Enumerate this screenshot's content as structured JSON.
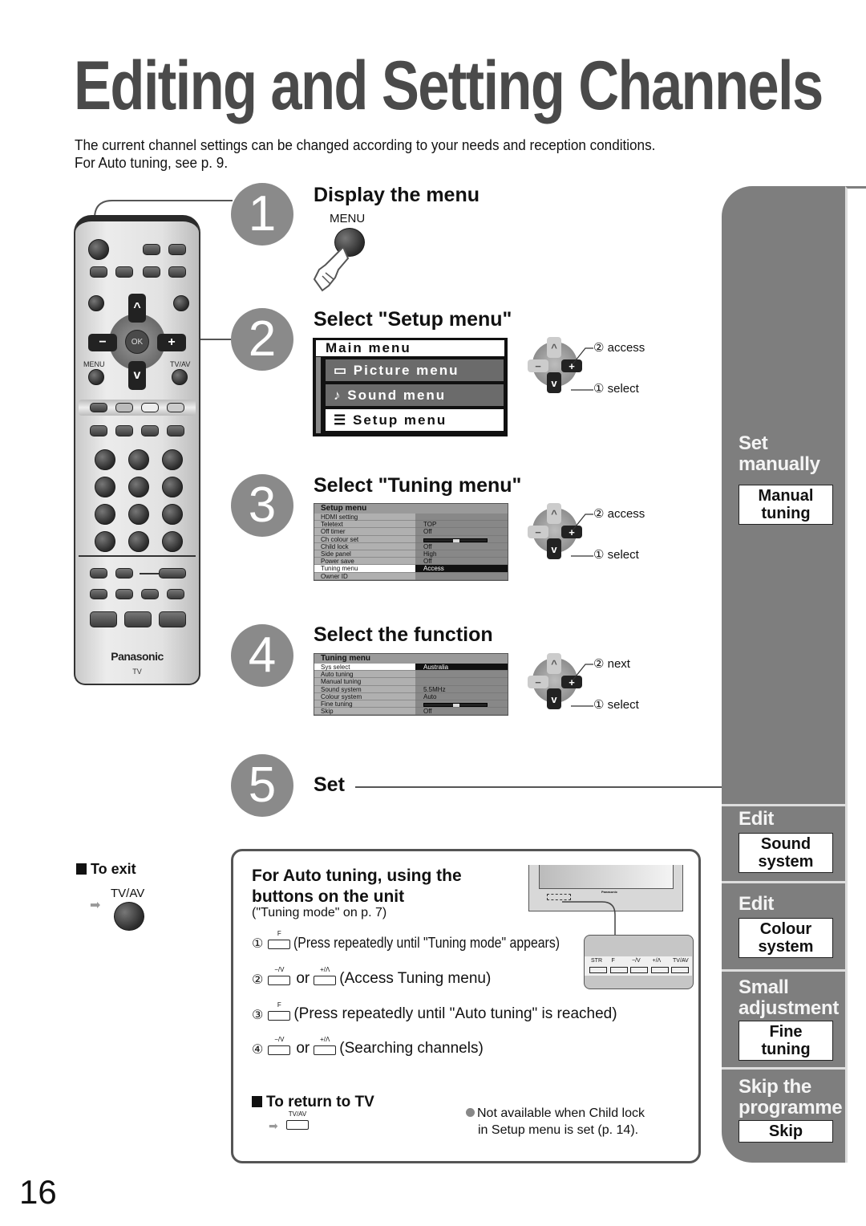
{
  "page": {
    "title": "Editing and Setting Channels",
    "intro_line1": "The current channel settings can be changed according to your needs and reception conditions.",
    "intro_line2": "For Auto tuning, see p. 9.",
    "page_number": "16"
  },
  "remote": {
    "menu_label": "MENU",
    "tvav_label": "TV/AV",
    "ok_label": "OK",
    "up_glyph": "^",
    "down_glyph": "v",
    "minus_glyph": "−",
    "plus_glyph": "+",
    "brand": "Panasonic",
    "brand_sub": "TV"
  },
  "steps": [
    {
      "num": "1",
      "title": "Display the menu",
      "button_label": "MENU"
    },
    {
      "num": "2",
      "title": "Select \"Setup menu\""
    },
    {
      "num": "3",
      "title": "Select \"Tuning menu\""
    },
    {
      "num": "4",
      "title": "Select the function"
    },
    {
      "num": "5",
      "title": "Set"
    }
  ],
  "main_menu": {
    "header": "Main menu",
    "items": [
      {
        "icon": "picture-icon",
        "glyph": "▭",
        "label": "Picture menu"
      },
      {
        "icon": "music-note-icon",
        "glyph": "♪",
        "label": "Sound menu"
      },
      {
        "icon": "list-icon",
        "glyph": "☰",
        "label": "Setup menu",
        "selected": true
      }
    ]
  },
  "setup_menu": {
    "header": "Setup menu",
    "rows": [
      {
        "label": "HDMI setting",
        "value": ""
      },
      {
        "label": "Teletext",
        "value": "TOP"
      },
      {
        "label": "Off timer",
        "value": "Off"
      },
      {
        "label": "Ch colour set",
        "value": "",
        "bar": 0.5
      },
      {
        "label": "Child lock",
        "value": "Off"
      },
      {
        "label": "Side panel",
        "value": "High"
      },
      {
        "label": "Power save",
        "value": "Off"
      },
      {
        "label": "Tuning menu",
        "value": "Access",
        "selected": true
      },
      {
        "label": "Owner ID",
        "value": ""
      }
    ]
  },
  "tuning_menu": {
    "header": "Tuning menu",
    "rows": [
      {
        "label": "Sys select",
        "value": "Australia",
        "selected": true
      },
      {
        "label": "Auto tuning",
        "value": ""
      },
      {
        "label": "Manual tuning",
        "value": ""
      },
      {
        "label": "Sound system",
        "value": "5.5MHz"
      },
      {
        "label": "Colour system",
        "value": "Auto"
      },
      {
        "label": "Fine tuning",
        "value": "",
        "bar": 0.5
      },
      {
        "label": "Skip",
        "value": "Off"
      }
    ]
  },
  "callouts": {
    "step2": {
      "top": "② access",
      "bottom": "① select"
    },
    "step3": {
      "top": "② access",
      "bottom": "① select"
    },
    "step4": {
      "top": "② next",
      "bottom": "① select"
    }
  },
  "to_exit": {
    "title": "To exit",
    "button_label": "TV/AV"
  },
  "auto_tuning": {
    "title_line1": "For Auto tuning, using the",
    "title_line2": "buttons on the unit",
    "subtitle": "(\"Tuning mode\" on p. 7)",
    "steps": [
      {
        "num": "①",
        "keys": [
          "F"
        ],
        "text": "(Press repeatedly until \"Tuning mode\" appears)"
      },
      {
        "num": "②",
        "keys": [
          "−/V",
          "+/Λ"
        ],
        "or": "or",
        "text": "(Access Tuning menu)"
      },
      {
        "num": "③",
        "keys": [
          "F"
        ],
        "text": "(Press repeatedly until \"Auto tuning\" is reached)"
      },
      {
        "num": "④",
        "keys": [
          "−/V",
          "+/Λ"
        ],
        "or": "or",
        "text": "(Searching channels)"
      }
    ],
    "panel_keys": [
      "STR",
      "F",
      "−/V",
      "+/Λ",
      "TV/AV"
    ],
    "tv_brand": "Panasonic",
    "return_title": "To return to TV",
    "return_key": "TV/AV",
    "note_line1": "Not available when Child lock",
    "note_line2": "in Setup menu is set (p. 14)."
  },
  "sidebar": {
    "sections": [
      {
        "heading_line1": "Set",
        "heading_line2": "manually",
        "box_line1": "Manual",
        "box_line2": "tuning"
      },
      {
        "heading_line1": "Edit",
        "heading_line2": "",
        "box_line1": "Sound",
        "box_line2": "system"
      },
      {
        "heading_line1": "Edit",
        "heading_line2": "",
        "box_line1": "Colour",
        "box_line2": "system"
      },
      {
        "heading_line1": "Small",
        "heading_line2": "adjustment",
        "box_line1": "Fine",
        "box_line2": "tuning"
      },
      {
        "heading_line1": "Skip the",
        "heading_line2": "programme",
        "box_line1": "Skip",
        "box_line2": ""
      }
    ]
  },
  "colors": {
    "step_circle": "#8a8a8a",
    "sidebar": "#7e7e7e",
    "title": "#4a4a4a"
  }
}
